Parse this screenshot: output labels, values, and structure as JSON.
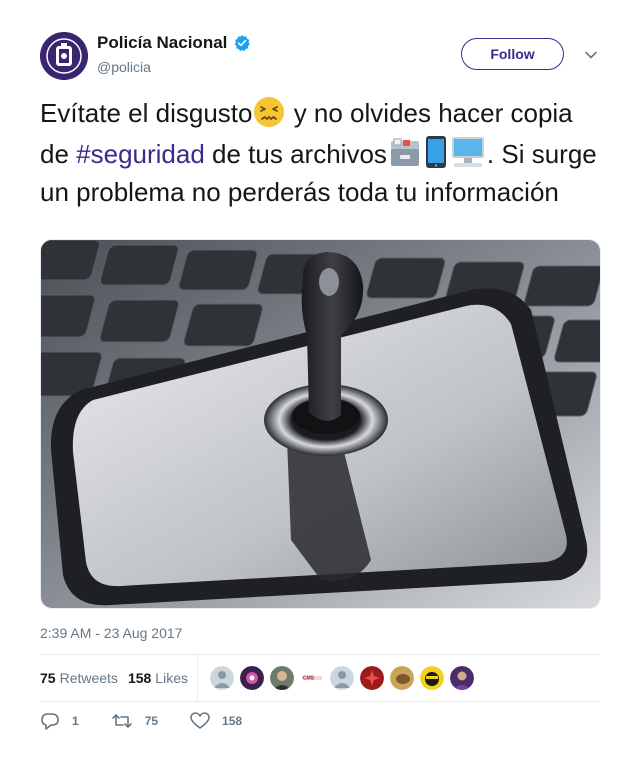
{
  "user": {
    "name": "Policía Nacional",
    "handle": "@policia",
    "verified": true
  },
  "follow_label": "Follow",
  "tweet": {
    "text_part1": "Evítate el disgusto",
    "text_part2": " y no olvides hacer copia de ",
    "hashtag": "#seguridad",
    "text_part3": " de tus archivos",
    "text_part4": ". Si surge un problema no perderás toda tu información",
    "emojis": [
      "confounded-face-icon",
      "card-file-box-icon",
      "mobile-phone-icon",
      "desktop-computer-icon"
    ]
  },
  "image_alt": "key inserted in smartphone lock on laptop keyboard",
  "timestamp": "2:39 AM - 23 Aug 2017",
  "stats": {
    "retweets_count": "75",
    "retweets_label": "Retweets",
    "likes_count": "158",
    "likes_label": "Likes"
  },
  "actions": {
    "replies": "1",
    "retweets": "75",
    "likes": "158"
  },
  "colors": {
    "accent": "#3b2a8f",
    "muted": "#657786",
    "verified": "#1da1f2"
  }
}
